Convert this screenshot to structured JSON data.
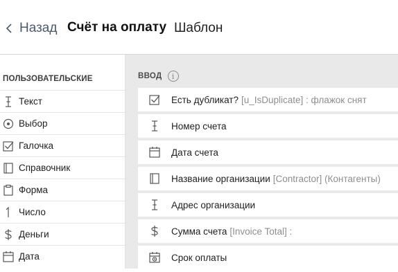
{
  "header": {
    "back_label": "Назад",
    "title": "Счёт на оплату",
    "subtitle": "Шаблон"
  },
  "palette": {
    "heading": "ПОЛЬЗОВАТЕЛЬСКИЕ",
    "items": [
      {
        "label": "Текст",
        "icon": "text-cursor-icon"
      },
      {
        "label": "Выбор",
        "icon": "radio-icon"
      },
      {
        "label": "Галочка",
        "icon": "checkbox-icon"
      },
      {
        "label": "Справочник",
        "icon": "book-icon"
      },
      {
        "label": "Форма",
        "icon": "clipboard-icon"
      },
      {
        "label": "Число",
        "icon": "number-icon"
      },
      {
        "label": "Деньги",
        "icon": "dollar-icon"
      },
      {
        "label": "Дата",
        "icon": "calendar-icon"
      }
    ]
  },
  "input_section": {
    "heading": "ВВОД",
    "info_glyph": "i",
    "fields": [
      {
        "label": "Есть дубликат?",
        "meta": "[u_IsDuplicate] : флажок снят",
        "icon": "checkbox-icon"
      },
      {
        "label": "Номер счета",
        "meta": "",
        "icon": "text-cursor-icon"
      },
      {
        "label": "Дата счета",
        "meta": "",
        "icon": "calendar-icon"
      },
      {
        "label": "Название организации",
        "meta": "[Contractor] (Контагенты)",
        "icon": "book-icon"
      },
      {
        "label": "Адрес организации",
        "meta": "",
        "icon": "text-cursor-icon"
      },
      {
        "label": "Сумма счета",
        "meta": "[Invoice Total] :",
        "icon": "dollar-icon"
      },
      {
        "label": "Срок оплаты",
        "meta": "",
        "icon": "calendar-clock-icon"
      }
    ]
  },
  "colors": {
    "canvas_bg": "#e9e9e9",
    "icon": "#555555",
    "meta_text": "#8e8e8e"
  }
}
